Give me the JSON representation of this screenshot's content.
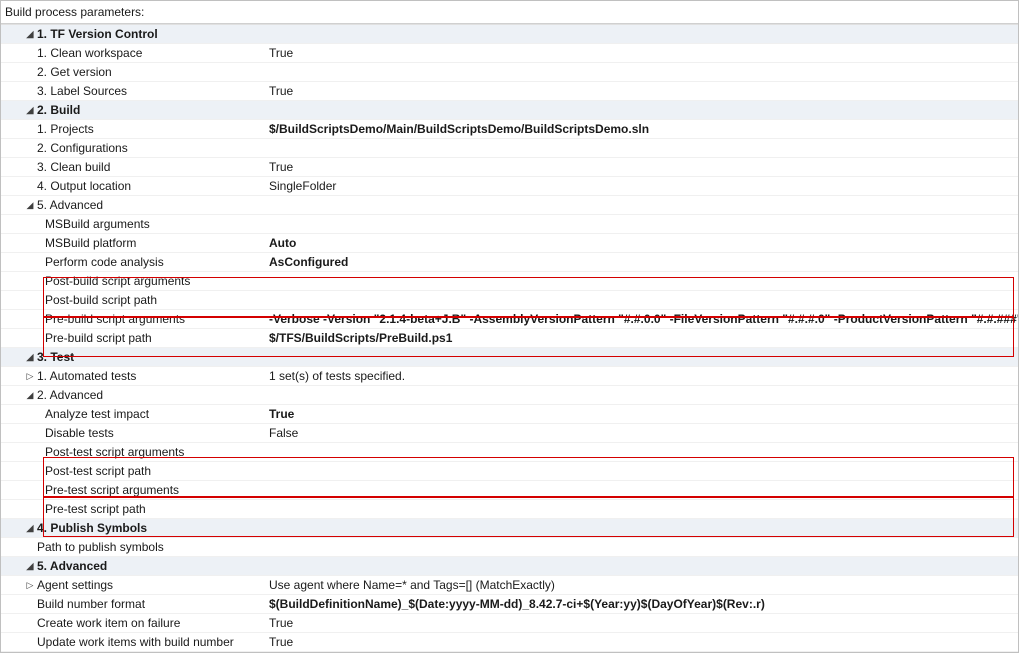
{
  "header": "Build process parameters:",
  "sections": {
    "tfvc": {
      "title": "1. TF Version Control",
      "clean_ws_label": "1. Clean workspace",
      "clean_ws_val": "True",
      "get_ver_label": "2. Get version",
      "get_ver_val": "",
      "label_src_label": "3. Label Sources",
      "label_src_val": "True"
    },
    "build": {
      "title": "2. Build",
      "projects_label": "1. Projects",
      "projects_val": "$/BuildScriptsDemo/Main/BuildScriptsDemo/BuildScriptsDemo.sln",
      "configs_label": "2. Configurations",
      "configs_val": "",
      "clean_label": "3. Clean build",
      "clean_val": "True",
      "output_label": "4. Output location",
      "output_val": "SingleFolder",
      "adv_label": "5. Advanced",
      "msbuild_args_label": "MSBuild arguments",
      "msbuild_args_val": "",
      "msbuild_plat_label": "MSBuild platform",
      "msbuild_plat_val": "Auto",
      "code_analysis_label": "Perform code analysis",
      "code_analysis_val": "AsConfigured",
      "post_args_label": "Post-build script arguments",
      "post_args_val": "",
      "post_path_label": "Post-build script path",
      "post_path_val": "",
      "pre_args_label": "Pre-build script arguments",
      "pre_args_val": "-Verbose -Version \"2.1.4-beta+J.B\" -AssemblyVersionPattern \"#.#.0.0\" -FileVersionPattern \"#.#.#.0\" -ProductVersionPattern \"#.#.###\"",
      "pre_path_label": "Pre-build script path",
      "pre_path_val": "$/TFS/BuildScripts/PreBuild.ps1"
    },
    "test": {
      "title": "3. Test",
      "auto_label": "1. Automated tests",
      "auto_val": "1 set(s) of tests specified.",
      "adv_label": "2. Advanced",
      "impact_label": "Analyze test impact",
      "impact_val": "True",
      "disable_label": "Disable tests",
      "disable_val": "False",
      "post_args_label": "Post-test script arguments",
      "post_args_val": "",
      "post_path_label": "Post-test script path",
      "post_path_val": "",
      "pre_args_label": "Pre-test script arguments",
      "pre_args_val": "",
      "pre_path_label": "Pre-test script path",
      "pre_path_val": ""
    },
    "publish": {
      "title": "4. Publish Symbols",
      "path_label": "Path to publish symbols",
      "path_val": ""
    },
    "advanced": {
      "title": "5. Advanced",
      "agent_label": "Agent settings",
      "agent_val": "Use agent where Name=* and Tags=[] (MatchExactly)",
      "bnf_label": "Build number format",
      "bnf_val": "$(BuildDefinitionName)_$(Date:yyyy-MM-dd)_8.42.7-ci+$(Year:yy)$(DayOfYear)$(Rev:.r)",
      "cwi_label": "Create work item on failure",
      "cwi_val": "True",
      "uwi_label": "Update work items with build number",
      "uwi_val": "True"
    }
  }
}
